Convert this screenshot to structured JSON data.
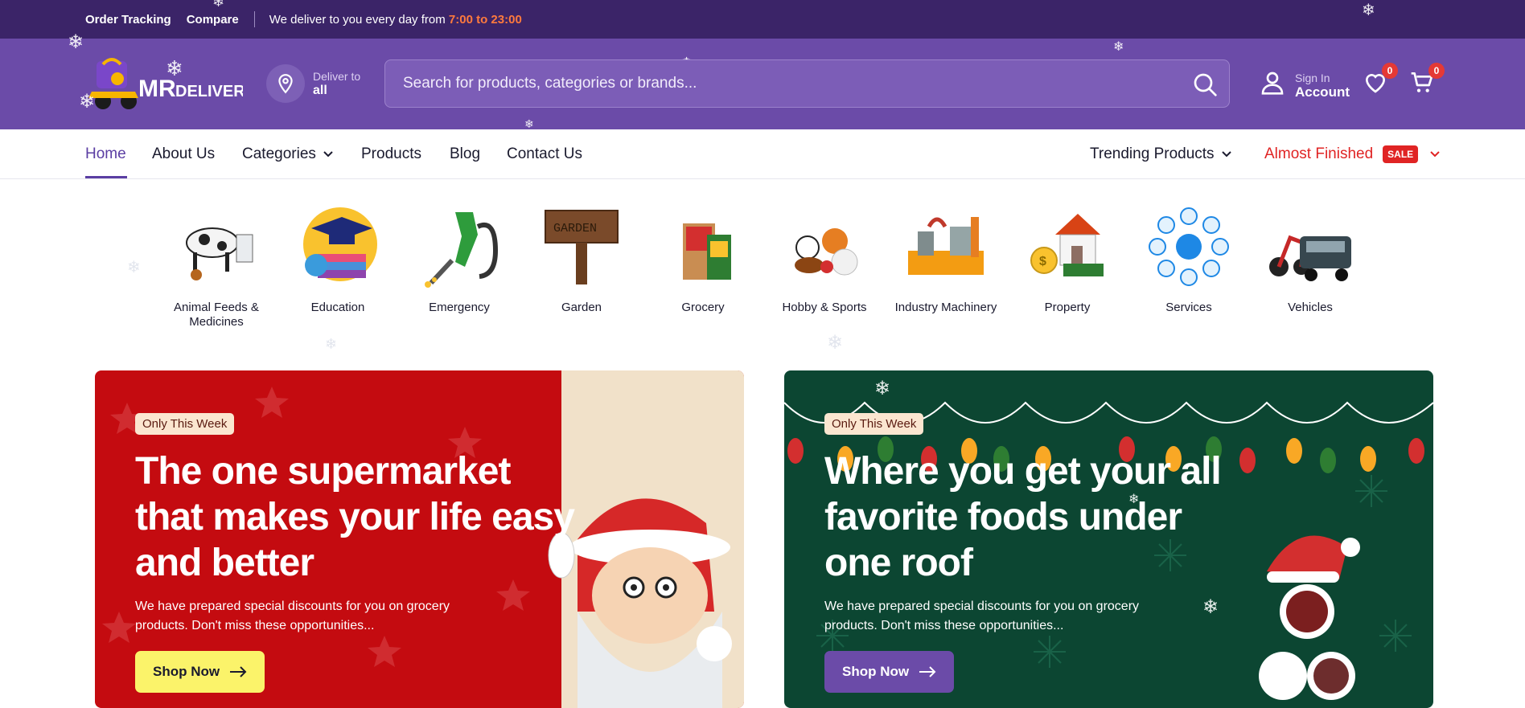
{
  "topbar": {
    "order_tracking": "Order Tracking",
    "compare": "Compare",
    "delivery_text": "We deliver to you every day from",
    "delivery_hours": "7:00 to 23:00"
  },
  "header": {
    "logo_text": "MR DELIVER",
    "deliver_to_label": "Deliver to",
    "deliver_to_value": "all",
    "search_placeholder": "Search for products, categories or brands...",
    "sign_in_label": "Sign In",
    "account_label": "Account",
    "wishlist_count": "0",
    "cart_count": "0"
  },
  "nav": {
    "items": [
      "Home",
      "About Us",
      "Categories",
      "Products",
      "Blog",
      "Contact Us"
    ],
    "trending": "Trending Products",
    "almost_finished": "Almost Finished",
    "sale_badge": "SALE"
  },
  "categories": [
    {
      "label": "Animal Feeds & Medicines",
      "icon": "cow-icon"
    },
    {
      "label": "Education",
      "icon": "graduation-cap-icon"
    },
    {
      "label": "Emergency",
      "icon": "fuel-nozzle-icon"
    },
    {
      "label": "Garden",
      "icon": "garden-sign-icon"
    },
    {
      "label": "Grocery",
      "icon": "grocery-bag-icon"
    },
    {
      "label": "Hobby & Sports",
      "icon": "sports-balls-icon"
    },
    {
      "label": "Industry Machinery",
      "icon": "machinery-icon"
    },
    {
      "label": "Property",
      "icon": "house-icon"
    },
    {
      "label": "Services",
      "icon": "services-icon"
    },
    {
      "label": "Vehicles",
      "icon": "vehicles-icon"
    }
  ],
  "banners": [
    {
      "pill": "Only This Week",
      "title": "The one supermarket that makes your life easy and better",
      "description": "We have prepared special discounts for you on grocery products. Don't miss these opportunities...",
      "button": "Shop Now",
      "bg": "#c40b10"
    },
    {
      "pill": "Only This Week",
      "title": "Where you get your all favorite foods under one roof",
      "description": "We have prepared special discounts for you on grocery products. Don't miss these opportunities...",
      "button": "Shop Now",
      "bg": "#0c4632"
    }
  ],
  "colors": {
    "topbar": "#3b2468",
    "header": "#6b4ba8",
    "accent": "#5b3ea3",
    "sale_red": "#e02424",
    "delivery_hours": "#ff7a3d"
  }
}
